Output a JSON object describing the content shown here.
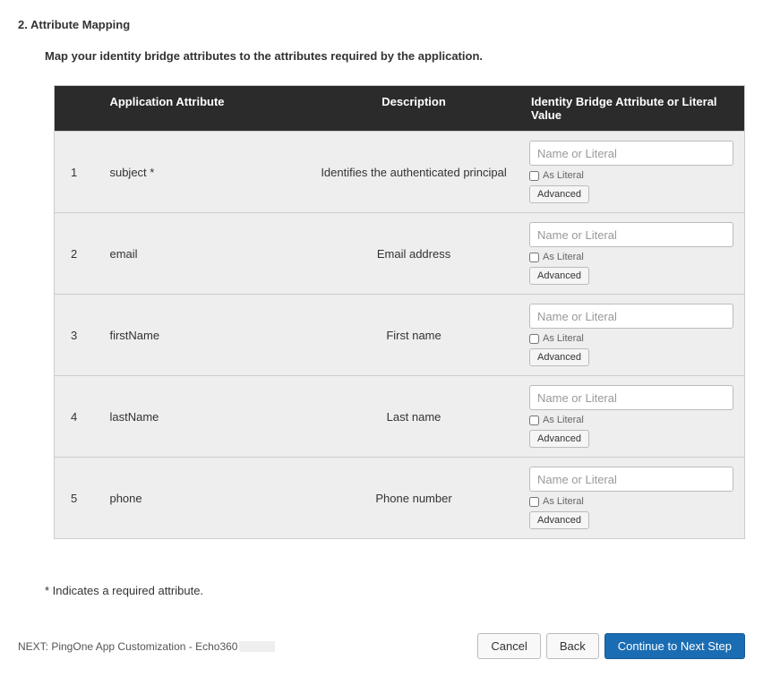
{
  "section": {
    "title": "2. Attribute Mapping",
    "description": "Map your identity bridge attributes to the attributes required by the application."
  },
  "table": {
    "headers": {
      "appAttr": "Application Attribute",
      "desc": "Description",
      "idb": "Identity Bridge Attribute or Literal Value"
    },
    "placeholder": "Name or Literal",
    "asLiteral": "As Literal",
    "advanced": "Advanced",
    "rows": [
      {
        "num": "1",
        "attr": "subject *",
        "desc": "Identifies the authenticated principal"
      },
      {
        "num": "2",
        "attr": "email",
        "desc": "Email address"
      },
      {
        "num": "3",
        "attr": "firstName",
        "desc": "First name"
      },
      {
        "num": "4",
        "attr": "lastName",
        "desc": "Last name"
      },
      {
        "num": "5",
        "attr": "phone",
        "desc": "Phone number"
      }
    ]
  },
  "footnote": "* Indicates a required attribute.",
  "footer": {
    "next": "NEXT: PingOne App Customization - Echo360",
    "cancel": "Cancel",
    "back": "Back",
    "continue": "Continue to Next Step"
  }
}
